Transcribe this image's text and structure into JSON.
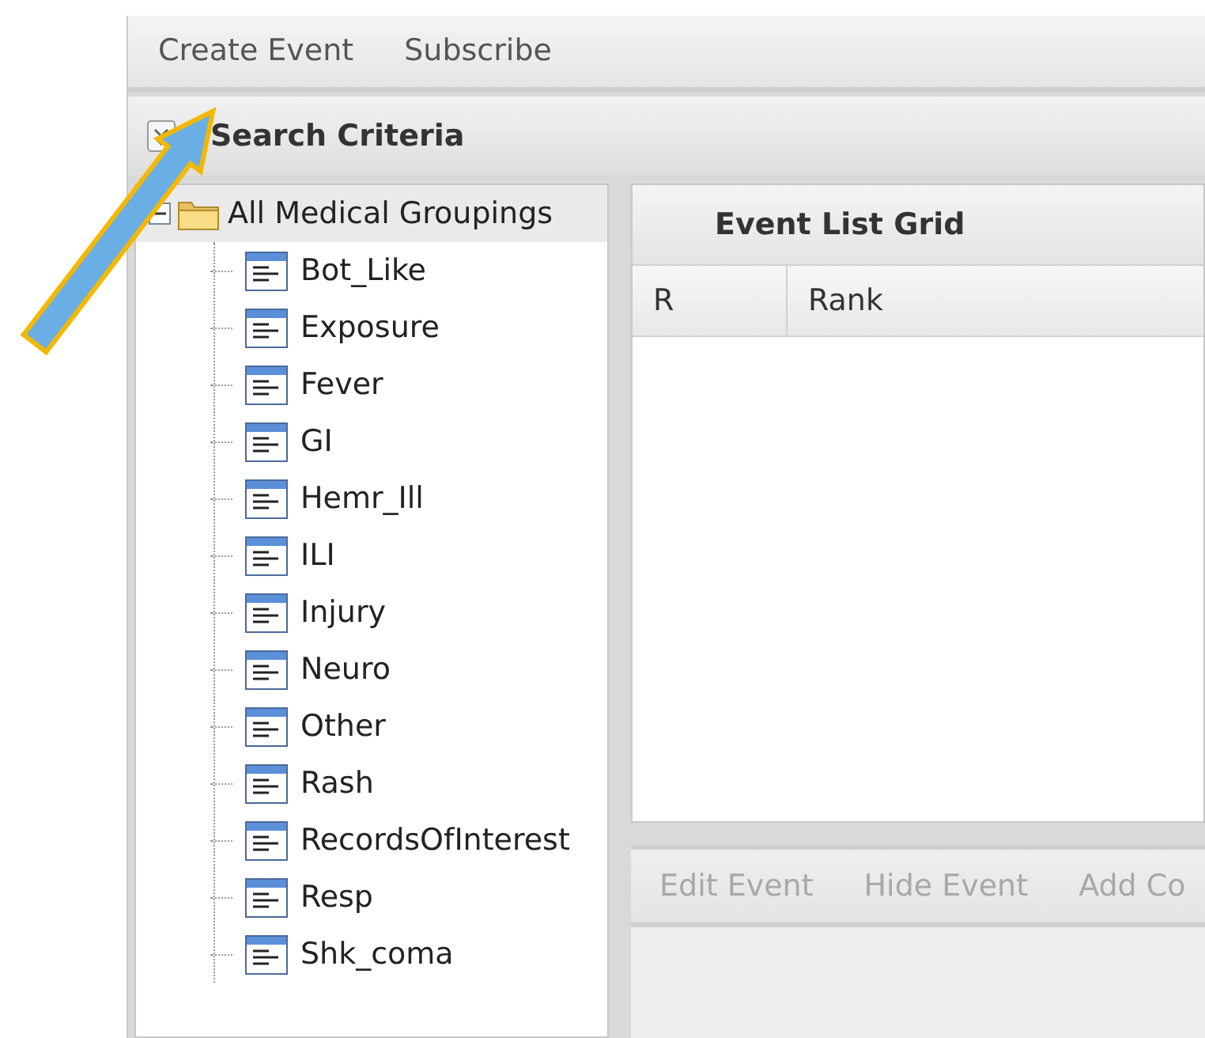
{
  "toolbar": [
    {
      "label": "Create Event",
      "disabled": false
    },
    {
      "label": "Subscribe",
      "disabled": false
    }
  ],
  "search_panel": {
    "title": "Search Criteria",
    "tree": {
      "label": "All Medical Groupings",
      "expanded": true,
      "children": [
        {
          "label": "Bot_Like"
        },
        {
          "label": "Exposure"
        },
        {
          "label": "Fever"
        },
        {
          "label": "GI"
        },
        {
          "label": "Hemr_Ill"
        },
        {
          "label": "ILI"
        },
        {
          "label": "Injury"
        },
        {
          "label": "Neuro"
        },
        {
          "label": "Other"
        },
        {
          "label": "Rash"
        },
        {
          "label": "RecordsOfInterest"
        },
        {
          "label": "Resp"
        },
        {
          "label": "Shk_coma"
        }
      ]
    }
  },
  "event_grid": {
    "title": "Event List Grid",
    "columns": [
      "R",
      "Rank"
    ]
  },
  "event_toolbar": [
    {
      "label": "Edit Event",
      "disabled": true
    },
    {
      "label": "Hide Event",
      "disabled": true
    },
    {
      "label": "Add Co",
      "disabled": true
    }
  ]
}
